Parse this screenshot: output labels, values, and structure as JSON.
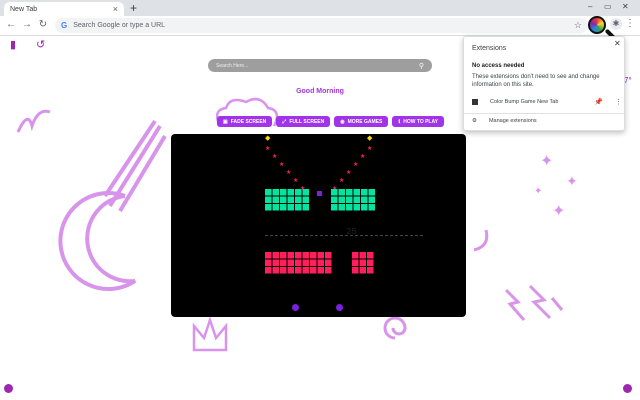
{
  "browser": {
    "tab_title": "New Tab",
    "tab_close": "×",
    "new_tab": "+",
    "window_controls": [
      "–",
      "▭",
      "✕"
    ],
    "omnibox_placeholder": "Search Google or type a URL",
    "nav": {
      "back": "←",
      "forward": "→",
      "reload": "↻"
    }
  },
  "newtab": {
    "search_placeholder": "Search Here...",
    "greeting": "Good Morning",
    "buttons": [
      {
        "label": "FADE SCREEN",
        "icon": "image-icon"
      },
      {
        "label": "FULL SCREEN",
        "icon": "fullscreen-icon"
      },
      {
        "label": "MORE GAMES",
        "icon": "gamepad-icon"
      },
      {
        "label": "HOW TO PLAY",
        "icon": "info-icon"
      }
    ],
    "clock_fragment": "7°",
    "game_score": "25",
    "colors": {
      "accent": "#a133e8",
      "green": "#00e5a0",
      "red": "#ff1f5a",
      "yellow": "#ffd600"
    }
  },
  "extensions_popup": {
    "title": "Extensions",
    "subtitle": "No access needed",
    "description": "These extensions don't need to see and change information on this site.",
    "item_name": "Color Bump Game New Tab",
    "manage_label": "Manage extensions"
  }
}
